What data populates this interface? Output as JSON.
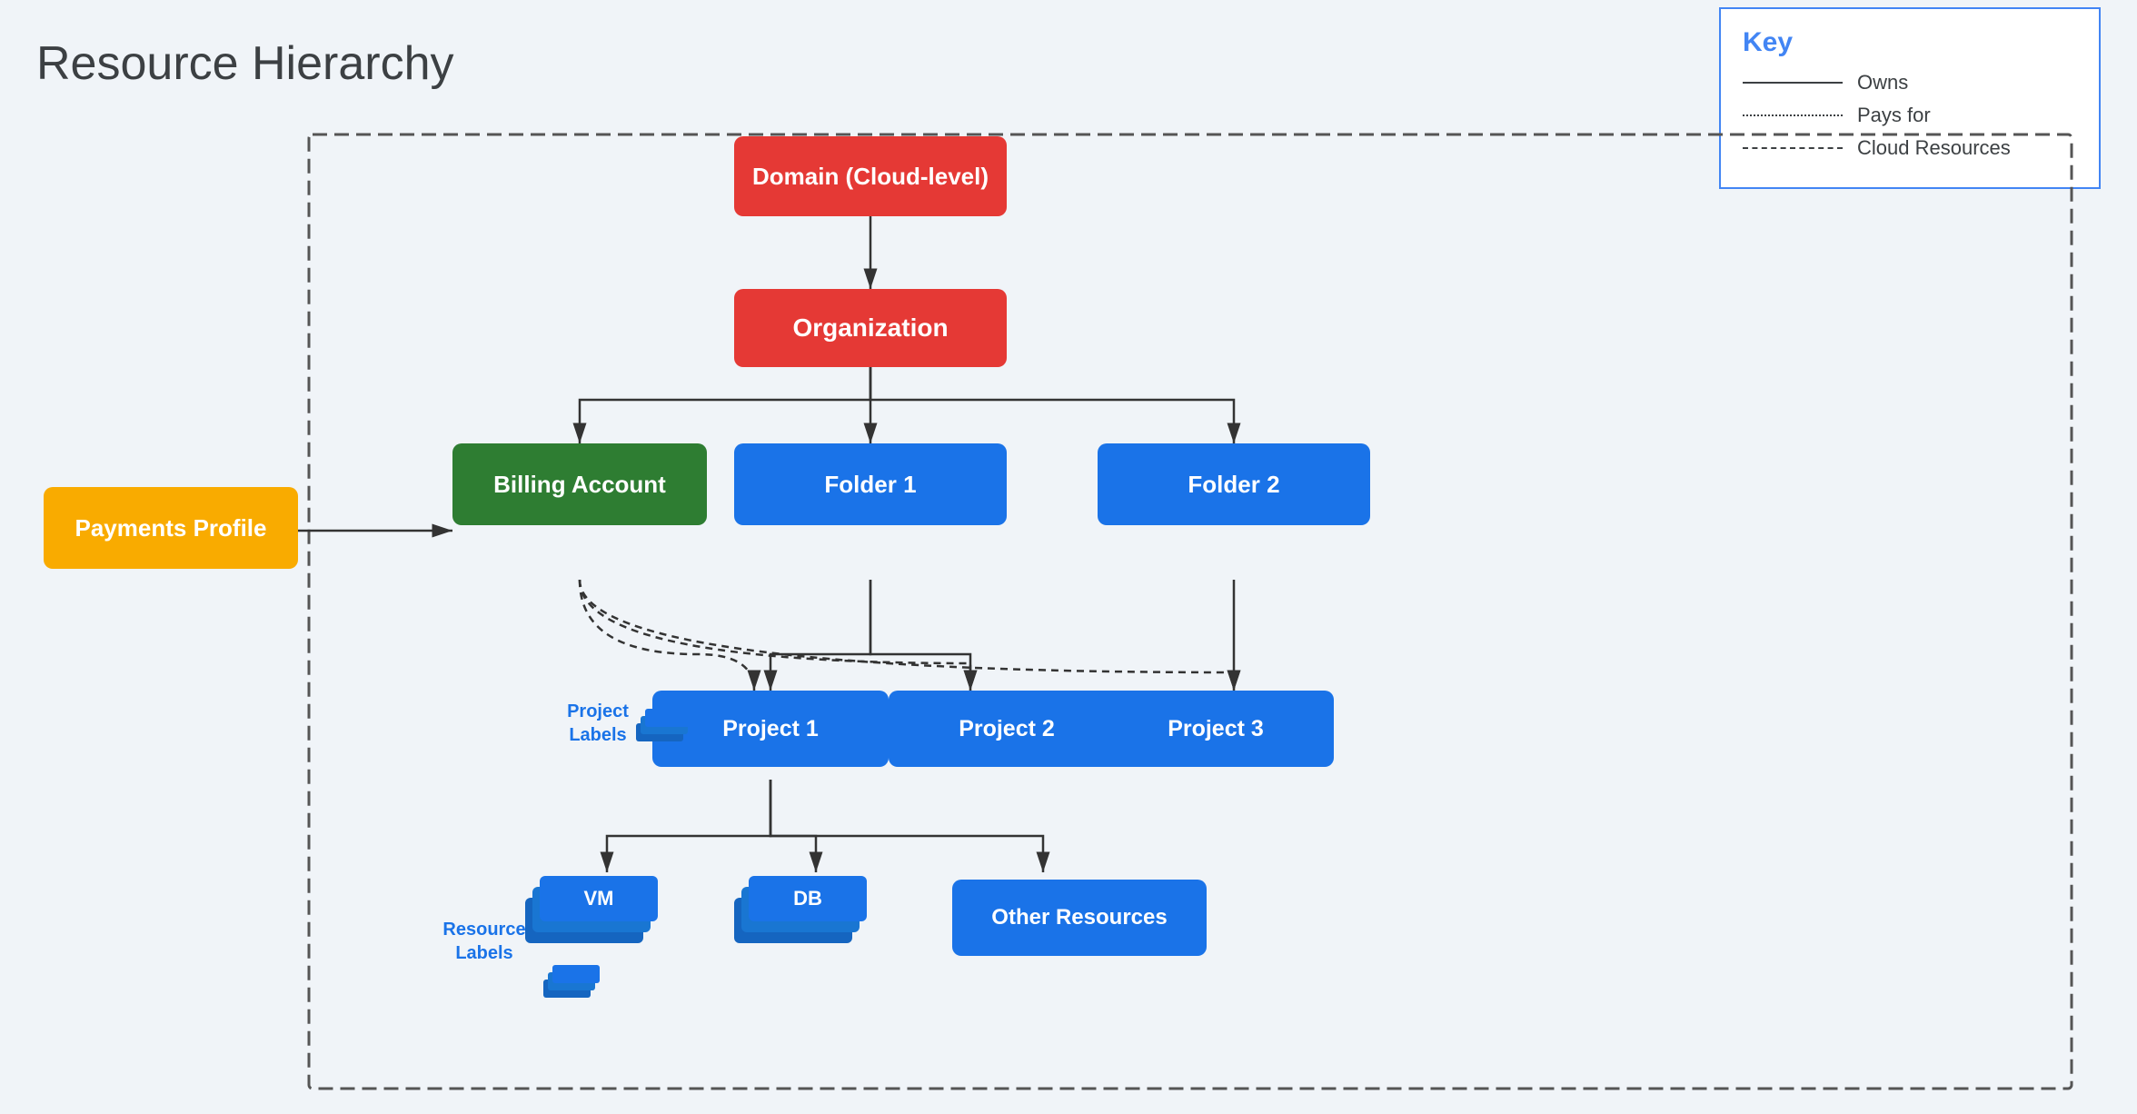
{
  "page": {
    "title": "Resource Hierarchy",
    "background": "#f0f4f8"
  },
  "key": {
    "title": "Key",
    "items": [
      {
        "type": "solid",
        "label": "Owns"
      },
      {
        "type": "dotted",
        "label": "Pays for"
      },
      {
        "type": "dashed",
        "label": "Cloud Resources"
      }
    ]
  },
  "nodes": {
    "domain": "Domain (Cloud-level)",
    "organization": "Organization",
    "billing_account": "Billing Account",
    "payments_profile": "Payments Profile",
    "folder1": "Folder 1",
    "folder2": "Folder 2",
    "project1": "Project 1",
    "project2": "Project 2",
    "project3": "Project 3",
    "vm": "VM",
    "db": "DB",
    "other_resources": "Other Resources",
    "project_labels": "Project\nLabels",
    "resource_labels": "Resource\nLabels"
  }
}
